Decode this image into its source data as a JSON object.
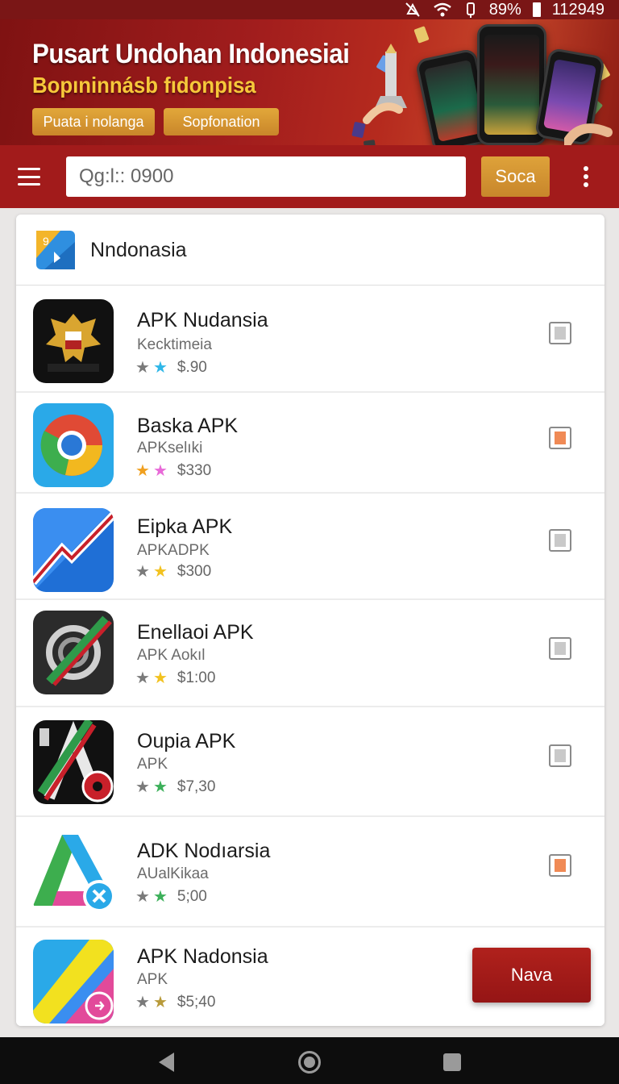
{
  "status_bar": {
    "battery": "89%",
    "time": "112949",
    "icons": [
      "mute-icon",
      "wifi-icon",
      "vibrate-icon",
      "battery-icon"
    ]
  },
  "banner": {
    "title": "Pusart Undohan Indonesiai",
    "subtitle": "Bopıninnásb fıdonpisa",
    "button_1": "Puata i nolanga",
    "button_2": "Sopfonation"
  },
  "toolbar": {
    "search_value": "Qg:l:: 0900",
    "search_button": "Soca",
    "menu_icon": "hamburger-menu-icon",
    "more_icon": "more-vert-icon"
  },
  "card": {
    "title": "Nndonasia"
  },
  "apps": [
    {
      "name": "APK Nudansia",
      "sub": "Kecktimeia",
      "price": "$.90",
      "star2_color": "#2fb7e8",
      "check": "grey"
    },
    {
      "name": "Baska APK",
      "sub": "APKselıki",
      "price": "$330",
      "star2_color": "#e86ad8",
      "check": "orange"
    },
    {
      "name": "Eipka APK",
      "sub": "APKADPK",
      "price": "$300",
      "star2_color": "#f2c21f",
      "check": "grey"
    },
    {
      "name": "Enellaoi APK",
      "sub": "APK Aokıl",
      "price": "$1:00",
      "star2_color": "#f2c21f",
      "check": "grey"
    },
    {
      "name": "Oupia APK",
      "sub": "APK",
      "price": "$7,30",
      "star2_color": "#3cb05a",
      "check": "grey"
    },
    {
      "name": "ADK Nodıarsia",
      "sub": "AUalKikaa",
      "price": "5;00",
      "star2_color": "#3cb05a",
      "check": "orange"
    },
    {
      "name": "APK Nadonsia",
      "sub": "APK",
      "price": "$5;40",
      "star2_color": "#b89a3a",
      "check": "grey"
    }
  ],
  "fab_label": "Nava",
  "colors": {
    "primary": "#a21b1b",
    "accent": "#d9992f",
    "star_grey": "#7a7a7a",
    "check_orange": "#f08a55"
  },
  "nav": {
    "back_icon": "back-triangle-icon",
    "home_icon": "home-circle-icon",
    "recents_icon": "recents-square-icon"
  }
}
